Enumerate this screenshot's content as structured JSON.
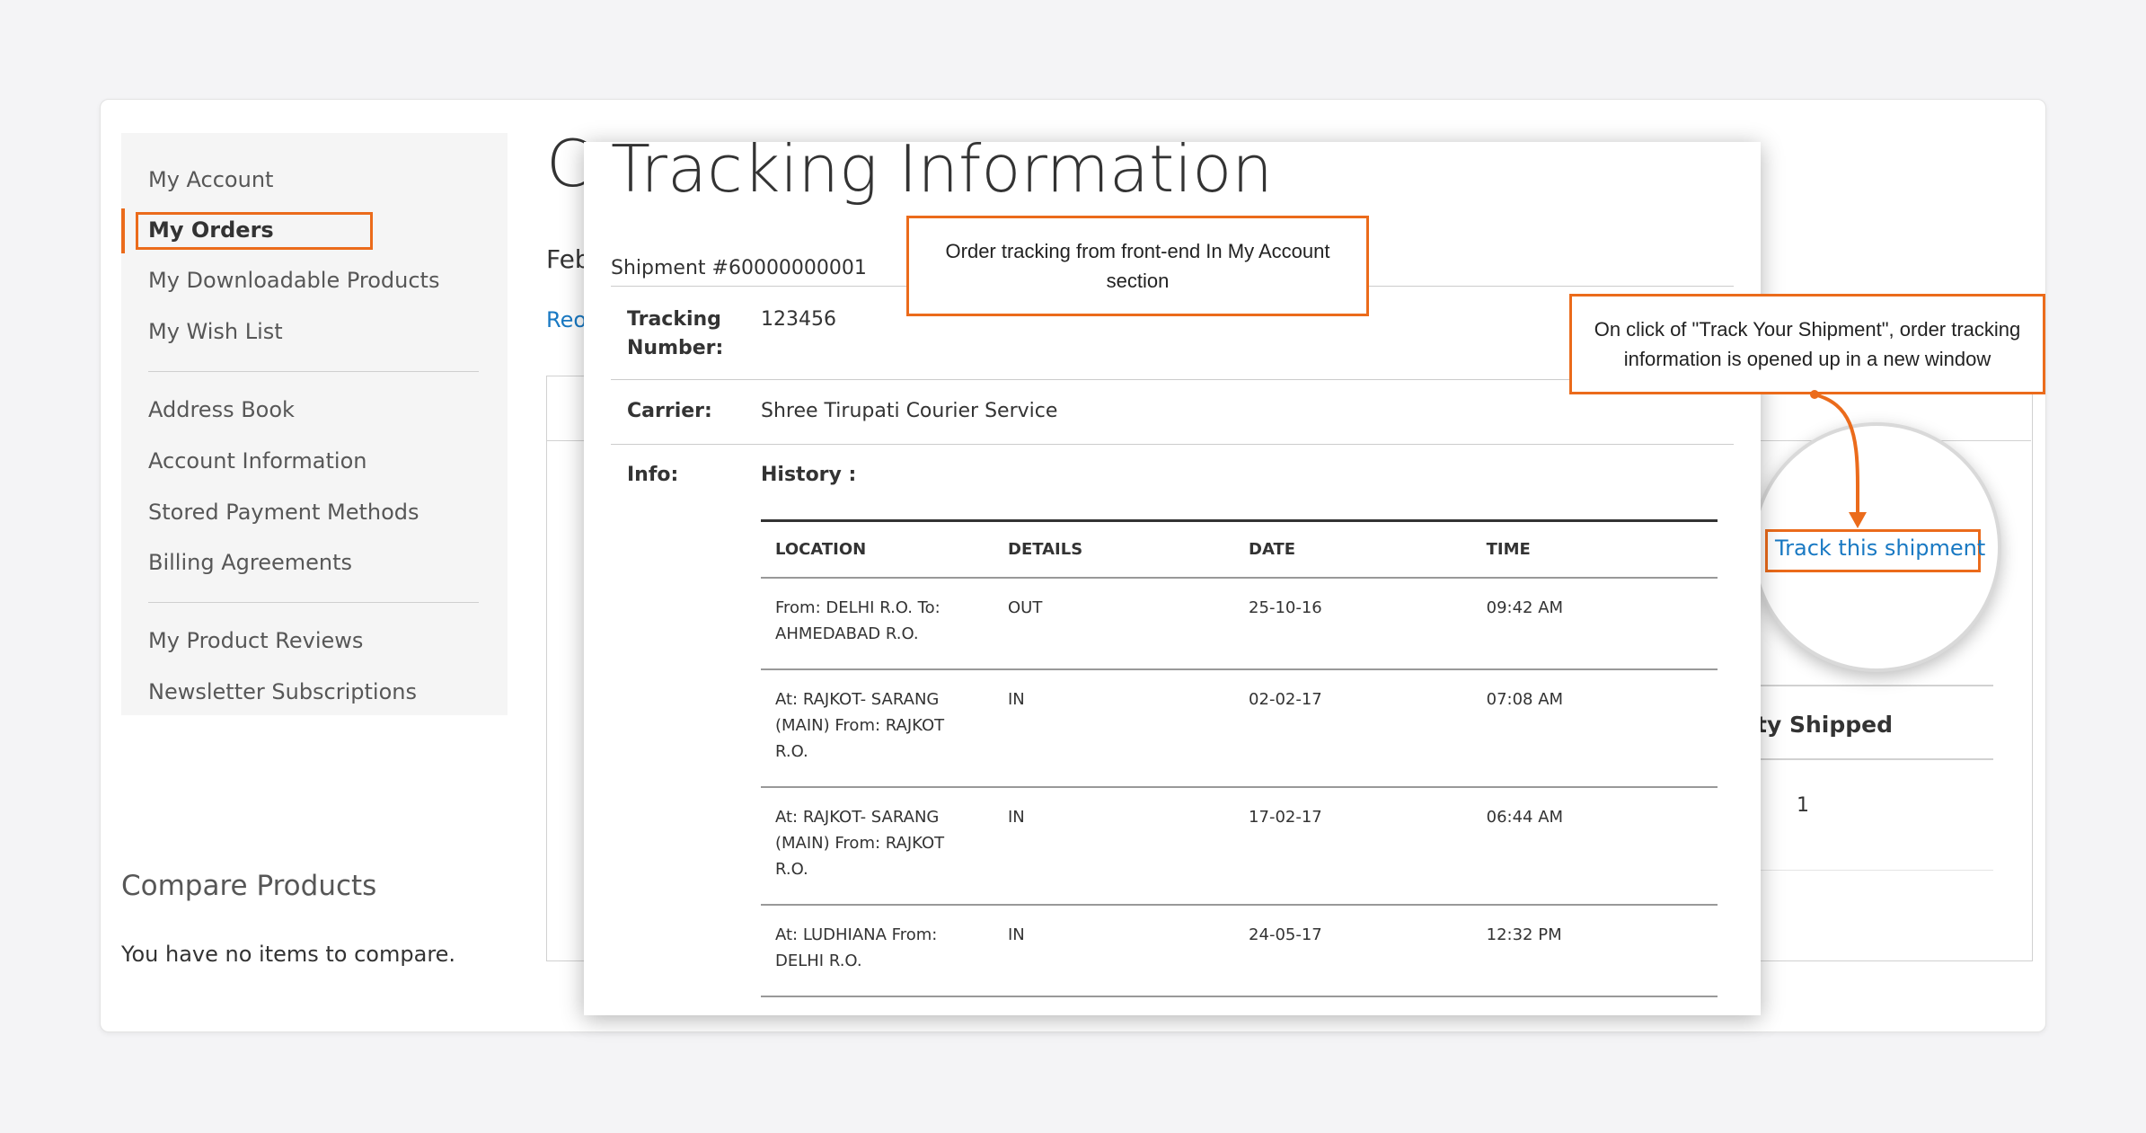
{
  "sidebar": {
    "items": [
      {
        "label": "My Account"
      },
      {
        "label": "My Orders"
      },
      {
        "label": "My Downloadable Products"
      },
      {
        "label": "My Wish List"
      },
      {
        "label": "Address Book"
      },
      {
        "label": "Account Information"
      },
      {
        "label": "Stored Payment Methods"
      },
      {
        "label": "Billing Agreements"
      },
      {
        "label": "My Product Reviews"
      },
      {
        "label": "Newsletter Subscriptions"
      }
    ]
  },
  "compare": {
    "title": "Compare Products",
    "empty_text": "You have no items to compare."
  },
  "background": {
    "title_fragment": "C",
    "date_fragment": "Feb",
    "link_fragment": "Reo",
    "qty_label_fragment": "ty Shipped",
    "qty_value": "1",
    "track_link": "Track this shipment"
  },
  "popup": {
    "title": "Tracking Information",
    "shipment": "Shipment #60000000001",
    "tracking_number_label": "Tracking Number:",
    "tracking_number": "123456",
    "carrier_label": "Carrier:",
    "carrier": "Shree Tirupati Courier Service",
    "info_label": "Info:",
    "history_label": "History :",
    "columns": [
      "LOCATION",
      "DETAILS",
      "DATE",
      "TIME"
    ],
    "rows": [
      {
        "location": "From: DELHI R.O. To: AHMEDABAD R.O.",
        "details": "OUT",
        "date": "25-10-16",
        "time": "09:42 AM"
      },
      {
        "location": "At: RAJKOT- SARANG (MAIN) From: RAJKOT R.O.",
        "details": "IN",
        "date": "02-02-17",
        "time": "07:08 AM"
      },
      {
        "location": "At: RAJKOT- SARANG (MAIN) From: RAJKOT R.O.",
        "details": "IN",
        "date": "17-02-17",
        "time": "06:44 AM"
      },
      {
        "location": "At: LUDHIANA From: DELHI R.O.",
        "details": "IN",
        "date": "24-05-17",
        "time": "12:32 PM"
      }
    ]
  },
  "callouts": {
    "front_end": "Order tracking from front-end In My Account section",
    "new_window": "On click of \"Track Your Shipment\", order tracking information is opened up in a new window"
  },
  "colors": {
    "accent": "#eb6b1b",
    "link": "#1979c3"
  }
}
